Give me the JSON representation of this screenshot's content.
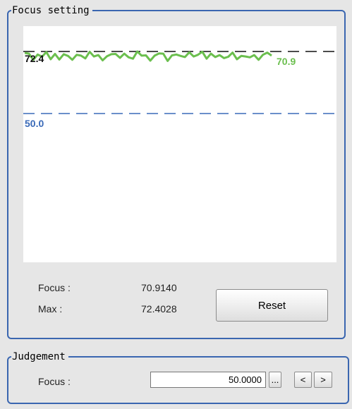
{
  "focus_setting": {
    "title": "Focus setting",
    "focus_label": "Focus :",
    "focus_value": "70.9140",
    "max_label": "Max :",
    "max_value": "72.4028",
    "reset_label": "Reset"
  },
  "chart_data": {
    "type": "line",
    "ylim": [
      0,
      100
    ],
    "max_line": {
      "value": 72.4,
      "label": "72.4",
      "color": "#111111"
    },
    "threshold_line": {
      "value": 50.0,
      "label": "50.0",
      "color": "#3a6ab8"
    },
    "series": [
      {
        "color": "#6bbf4e",
        "current_label": "70.9",
        "values": [
          71.9,
          71.6,
          69.4,
          71.3,
          70.5,
          72.2,
          69.6,
          71.5,
          69.5,
          71.4,
          70.8,
          69.4,
          71.2,
          70.9,
          69.9,
          72.3,
          70.6,
          71.1,
          69.2,
          70.7,
          71.4,
          71.5,
          70.1,
          71.6,
          70.3,
          69.8,
          72.4,
          70.9,
          71.0,
          69.1,
          70.9,
          71.7,
          71.6,
          69.0,
          71.0,
          71.3,
          70.8,
          70.4,
          72.1,
          70.6,
          71.2,
          72.3,
          69.8,
          71.6,
          70.4,
          71.1,
          70.0,
          70.5,
          72.0,
          69.6,
          70.8,
          70.6,
          70.3,
          71.1,
          69.4,
          71.2,
          72.0,
          70.9
        ]
      }
    ]
  },
  "judgement": {
    "title": "Judgement",
    "focus_label": "Focus :",
    "focus_input_value": "50.0000",
    "ellipsis_label": "...",
    "prev_label": "<",
    "next_label": ">"
  }
}
